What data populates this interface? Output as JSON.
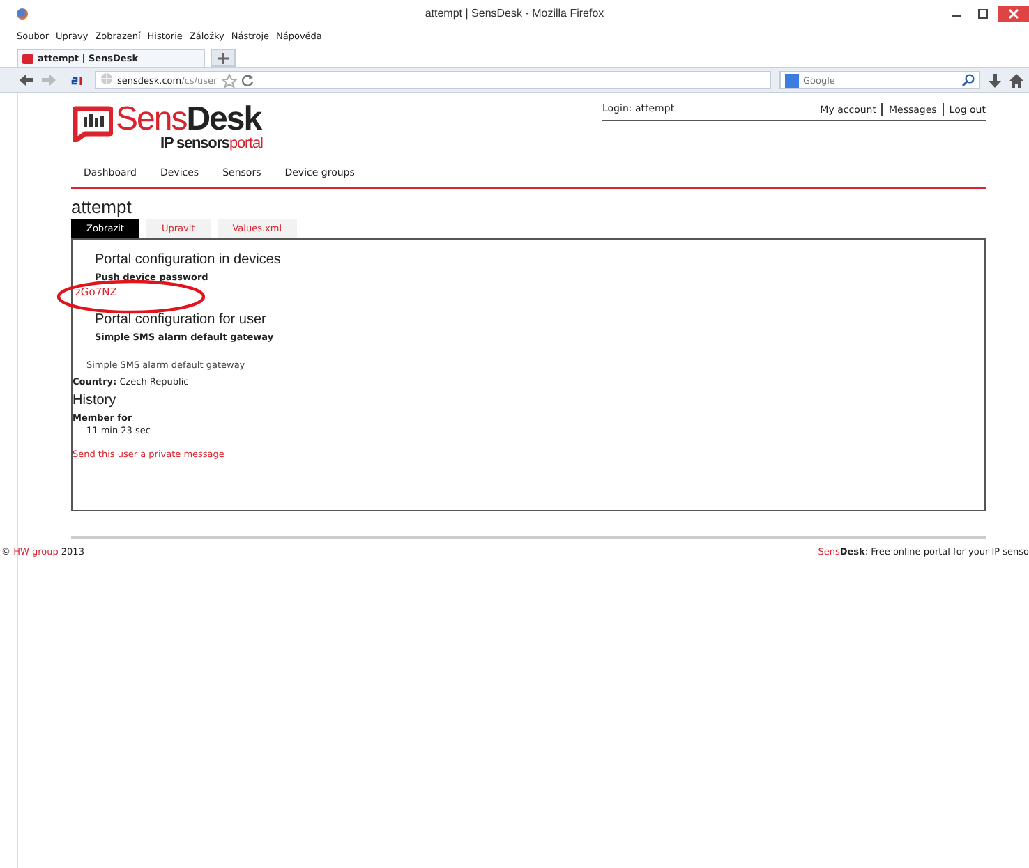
{
  "window": {
    "title": "attempt | SensDesk - Mozilla Firefox"
  },
  "menu_bar": [
    "Soubor",
    "Úpravy",
    "Zobrazení",
    "Historie",
    "Záložky",
    "Nástroje",
    "Nápověda"
  ],
  "browser_tabs": [
    {
      "label": "attempt | SensDesk",
      "selected": true
    }
  ],
  "address_bar": {
    "domain": "sensdesk.com",
    "path": "/cs/user"
  },
  "search_box": {
    "placeholder": "Google"
  },
  "header": {
    "logo": {
      "first": "Sens",
      "second": "Desk",
      "sub_first": "IP sensors",
      "sub_second": "portal"
    },
    "login": "Login: attempt",
    "links": [
      "My account",
      "Messages",
      "Log out"
    ]
  },
  "nav": [
    "Dashboard",
    "Devices",
    "Sensors",
    "Device groups"
  ],
  "page_title": "attempt",
  "tabs": [
    {
      "label": "Zobrazit",
      "selected": true
    },
    {
      "label": "Upravit",
      "selected": false
    },
    {
      "label": "Values.xml",
      "selected": false
    }
  ],
  "sections": [
    {
      "heading": "Portal configuration in devices",
      "label": "Push device password",
      "value": "zGo7NZ",
      "kind": "link",
      "highlighted": true
    },
    {
      "heading": "Portal configuration for user",
      "label": "Simple SMS alarm default gateway",
      "value": "Simple SMS alarm default gateway",
      "kind": "plain"
    }
  ],
  "country": {
    "label": "Country:",
    "value": "Czech Republic"
  },
  "history": {
    "heading": "History",
    "label": "Member for",
    "value": "11 min 23 sec"
  },
  "message_link": "Send this user a private message",
  "footer": {
    "copyright": "©",
    "company": "HW group",
    "year": "2013",
    "brand_first": "Sens",
    "brand_second": "Desk",
    "tagline": ": Free online portal for your IP senso"
  }
}
